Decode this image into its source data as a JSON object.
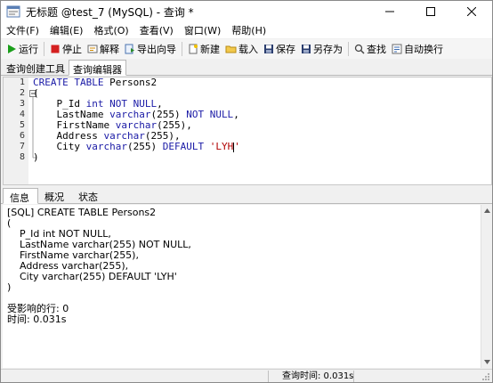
{
  "window": {
    "title": "无标题 @test_7 (MySQL) - 查询 *"
  },
  "menu": {
    "items": [
      {
        "label": "文件(F)"
      },
      {
        "label": "编辑(E)"
      },
      {
        "label": "格式(O)"
      },
      {
        "label": "查看(V)"
      },
      {
        "label": "窗口(W)"
      },
      {
        "label": "帮助(H)"
      }
    ]
  },
  "toolbar": {
    "run": "运行",
    "stop": "停止",
    "explain": "解释",
    "export_wizard": "导出向导",
    "new": "新建",
    "load": "载入",
    "save": "保存",
    "save_as": "另存为",
    "find": "查找",
    "auto_wrap": "自动换行"
  },
  "tabs": {
    "builder": "查询创建工具",
    "editor": "查询编辑器"
  },
  "editor": {
    "line_numbers": [
      "1",
      "2",
      "3",
      "4",
      "5",
      "6",
      "7",
      "8"
    ],
    "lines": [
      [
        {
          "t": "CREATE TABLE ",
          "c": "kw"
        },
        {
          "t": "Persons2",
          "c": ""
        }
      ],
      [
        {
          "t": "(",
          "c": ""
        }
      ],
      [
        {
          "t": "    P_Id ",
          "c": ""
        },
        {
          "t": "int NOT NULL",
          "c": "kw"
        },
        {
          "t": ",",
          "c": ""
        }
      ],
      [
        {
          "t": "    LastName ",
          "c": ""
        },
        {
          "t": "varchar",
          "c": "kw"
        },
        {
          "t": "(255) ",
          "c": ""
        },
        {
          "t": "NOT NULL",
          "c": "kw"
        },
        {
          "t": ",",
          "c": ""
        }
      ],
      [
        {
          "t": "    FirstName ",
          "c": ""
        },
        {
          "t": "varchar",
          "c": "kw"
        },
        {
          "t": "(255),",
          "c": ""
        }
      ],
      [
        {
          "t": "    Address ",
          "c": ""
        },
        {
          "t": "varchar",
          "c": "kw"
        },
        {
          "t": "(255),",
          "c": ""
        }
      ],
      [
        {
          "t": "    City ",
          "c": ""
        },
        {
          "t": "varchar",
          "c": "kw"
        },
        {
          "t": "(255) ",
          "c": ""
        },
        {
          "t": "DEFAULT ",
          "c": "kw"
        },
        {
          "t": "'LYH'",
          "c": "str"
        }
      ],
      [
        {
          "t": ")",
          "c": ""
        }
      ]
    ]
  },
  "bottom_tabs": {
    "info": "信息",
    "overview": "概况",
    "status": "状态"
  },
  "messages": {
    "lines": [
      "[SQL] CREATE TABLE Persons2",
      "(",
      "    P_Id int NOT NULL,",
      "    LastName varchar(255) NOT NULL,",
      "    FirstName varchar(255),",
      "    Address varchar(255),",
      "    City varchar(255) DEFAULT 'LYH'",
      ")",
      "",
      "受影响的行: 0",
      "时间: 0.031s"
    ]
  },
  "statusbar": {
    "query_time": "查询时间: 0.031s"
  },
  "colors": {
    "keyword": "#1a1aa6",
    "string": "#b00000",
    "run_green": "#1a9e1a",
    "stop_red": "#d42020"
  }
}
